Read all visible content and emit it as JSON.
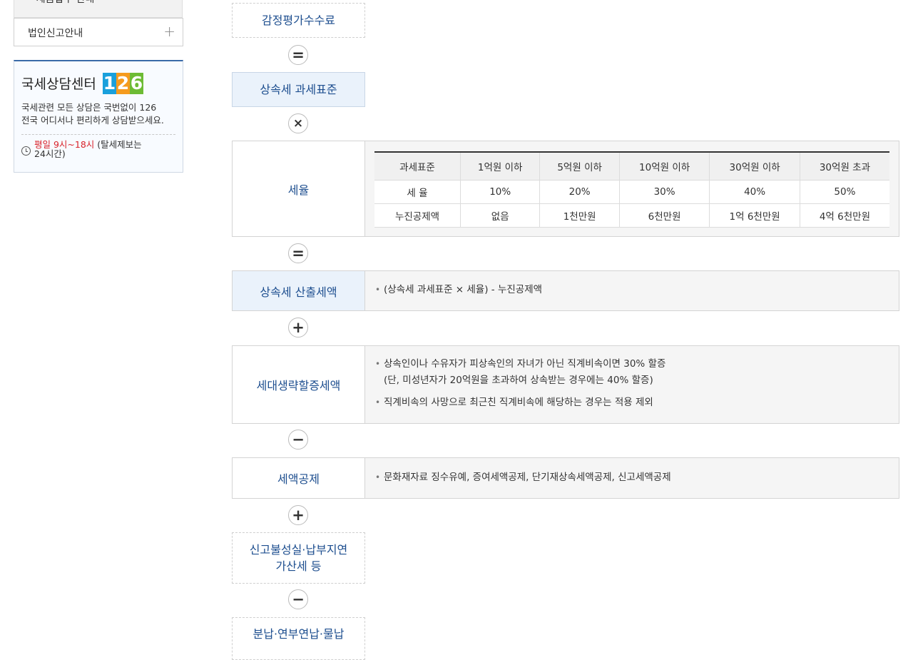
{
  "sidebar": {
    "prev_item": "• 세금납부 안내",
    "menu_item": "법인신고안내",
    "menu_plus": "+",
    "consult": {
      "title": "국세상담센터",
      "number_digits": [
        "1",
        "2",
        "6"
      ],
      "digit_colors": [
        "#1aa0dc",
        "#f59b1e",
        "#6dbb34"
      ],
      "desc_line1": "국세관련 모든 상담은 국번없이 126",
      "desc_line2": "전국 어디서나 편리하게 상담받으세요.",
      "hours_red": "평일 9시~18시",
      "hours_rest": "(탈세제보는",
      "hours_line2": "24시간)"
    }
  },
  "flow": {
    "appraisal_fee": "감정평가수수료",
    "op1": "=",
    "tax_base": "상속세 과세표준",
    "op2": "×",
    "rate": {
      "label": "세율",
      "headers": [
        "과세표준",
        "1억원 이하",
        "5억원 이하",
        "10억원 이하",
        "30억원 이하",
        "30억원 초과"
      ],
      "rows": [
        [
          "세 율",
          "10%",
          "20%",
          "30%",
          "40%",
          "50%"
        ],
        [
          "누진공제액",
          "없음",
          "1천만원",
          "6천만원",
          "1억 6천만원",
          "4억 6천만원"
        ]
      ]
    },
    "op3": "=",
    "calculated_tax": {
      "label": "상속세 산출세액",
      "bullets": [
        "(상속세 과세표준 × 세율) -  누진공제액"
      ]
    },
    "op4": "+",
    "generation_skip": {
      "label": "세대생략할증세액",
      "bullet1_line1": "상속인이나 수유자가 피상속인의 자녀가 아닌 직계비속이면 30% 할증",
      "bullet1_line2": "(단, 미성년자가 20억원을 초과하여 상속받는 경우에는 40% 할증)",
      "bullet2": "직계비속의 사망으로 최근친 직계비속에 해당하는 경우는 적용 제외"
    },
    "op5": "−",
    "tax_credit": {
      "label": "세액공제",
      "bullets": [
        "문화재자료 징수유예, 증여세액공제, 단기재상속세액공제, 신고세액공제"
      ]
    },
    "op6": "+",
    "penalty": {
      "line1": "신고불성실·납부지연",
      "line2": "가산세 등"
    },
    "op7": "−",
    "installment": "분납·연부연납·물납"
  }
}
